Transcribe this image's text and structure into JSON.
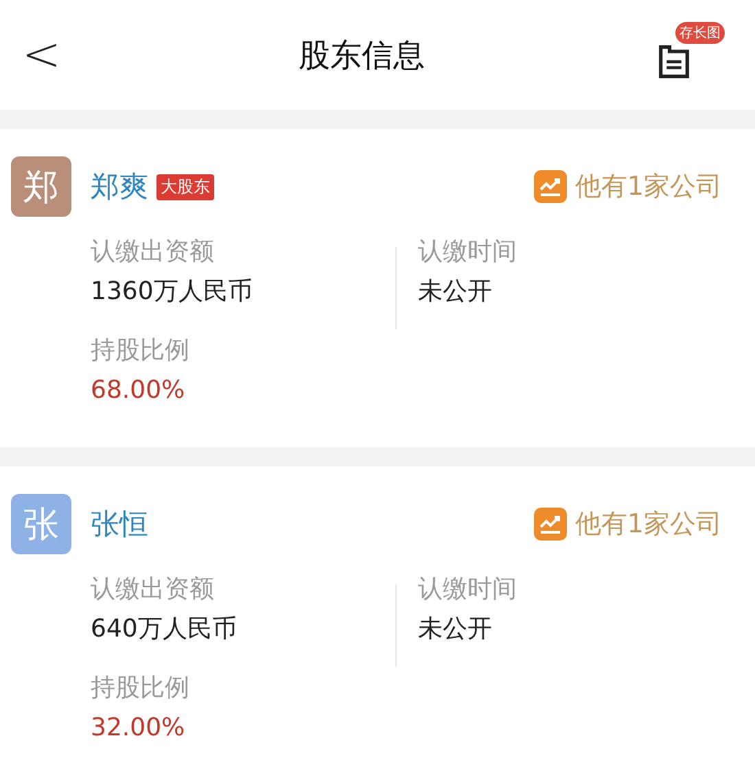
{
  "header": {
    "back": "<",
    "title": "股东信息",
    "save_badge": "存长图"
  },
  "shareholders": [
    {
      "avatar": "郑",
      "color": "#b98f7a",
      "name": "郑爽",
      "tag": "大股东",
      "companies": "他有1家公司",
      "amount_label": "认缴出资额",
      "amount": "1360万人民币",
      "time_label": "认缴时间",
      "time": "未公开",
      "ratio_label": "持股比例",
      "ratio": "68.00%"
    },
    {
      "avatar": "张",
      "color": "#8fb2e6",
      "name": "张恒",
      "companies": "他有1家公司",
      "amount_label": "认缴出资额",
      "amount": "640万人民币",
      "time_label": "认缴时间",
      "time": "未公开",
      "ratio_label": "持股比例",
      "ratio": "32.00%"
    }
  ]
}
